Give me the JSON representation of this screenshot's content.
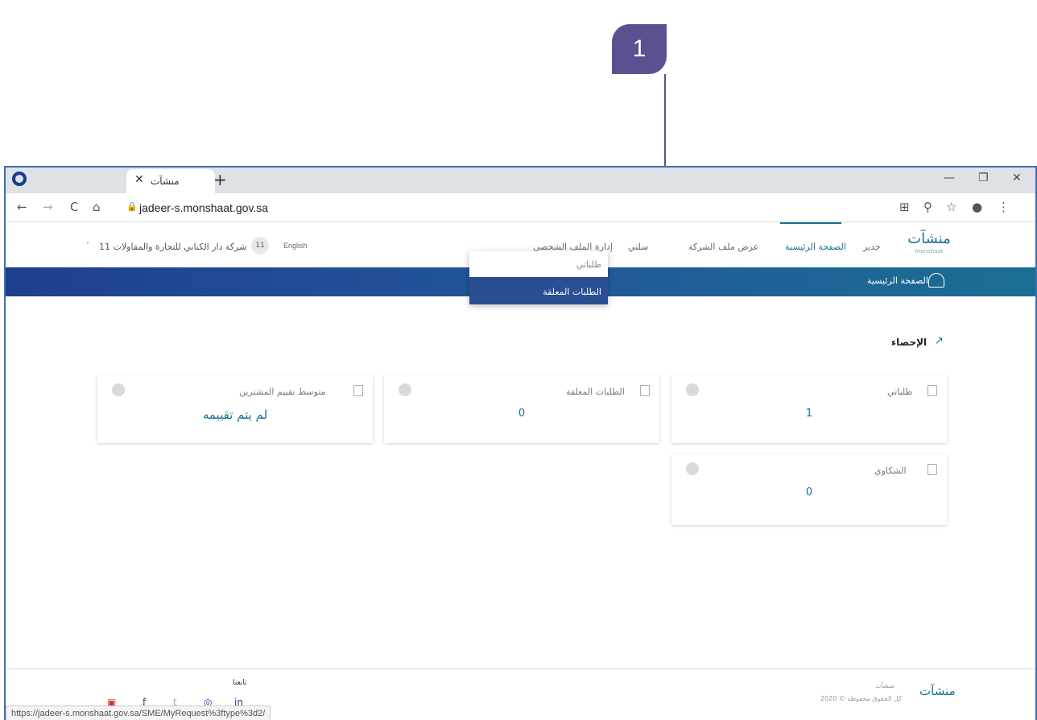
{
  "callout": {
    "number": "1"
  },
  "browser": {
    "tab_title": "منشآت",
    "tab_close": "✕",
    "new_tab": "+",
    "url": "jadeer-s.monshaat.gov.sa",
    "status_url": "https://jadeer-s.monshaat.gov.sa/SME/MyRequest%3ftype%3d2/",
    "controls": {
      "minimize": "—",
      "restore": "❐",
      "close": "✕"
    },
    "nav": {
      "back": "←",
      "forward": "→",
      "reload": "C",
      "home": "⌂"
    },
    "toolbar": {
      "translate": "⊞",
      "zoom": "⚲",
      "star": "☆",
      "profile": "●",
      "menu": "⋮"
    }
  },
  "header": {
    "logo": "منشآت",
    "logo_sub": "monshaat",
    "brand_link": "جدير",
    "nav": [
      {
        "label": "الصفحة الرئيسية"
      },
      {
        "label": "عرض ملف الشركة"
      },
      {
        "label": "سلتي"
      },
      {
        "label": "إدارة الملف الشخصي"
      }
    ],
    "language": "English",
    "cart_count": "11",
    "company": "شركة دار الكناني للتجارة والمقاولات 11"
  },
  "bluebar": {
    "home_label": "الصفحة الرئيسية"
  },
  "dropdown": {
    "items": [
      {
        "label": "طلباتي"
      },
      {
        "label": "الطلبات المعلقة"
      }
    ]
  },
  "stats": {
    "title": "الإحصاء",
    "cards": [
      {
        "label": "طلباتي",
        "value": "1"
      },
      {
        "label": "الطلبات المعلقة",
        "value": "0"
      },
      {
        "label": "متوسط تقييم المشترين",
        "value": "لم يتم تقييمه"
      },
      {
        "label": "الشكاوي",
        "value": "0"
      }
    ]
  },
  "footer": {
    "brand": "منشآت",
    "copyright": "كل الحقوق محفوظة © 2020",
    "follow": "تابعنا",
    "social": [
      "▣",
      "f",
      "t",
      "◎",
      "in"
    ]
  },
  "colors": {
    "primary": "#1a6f92",
    "accent": "#5b5190",
    "bar_dark": "#1e3f8f"
  }
}
